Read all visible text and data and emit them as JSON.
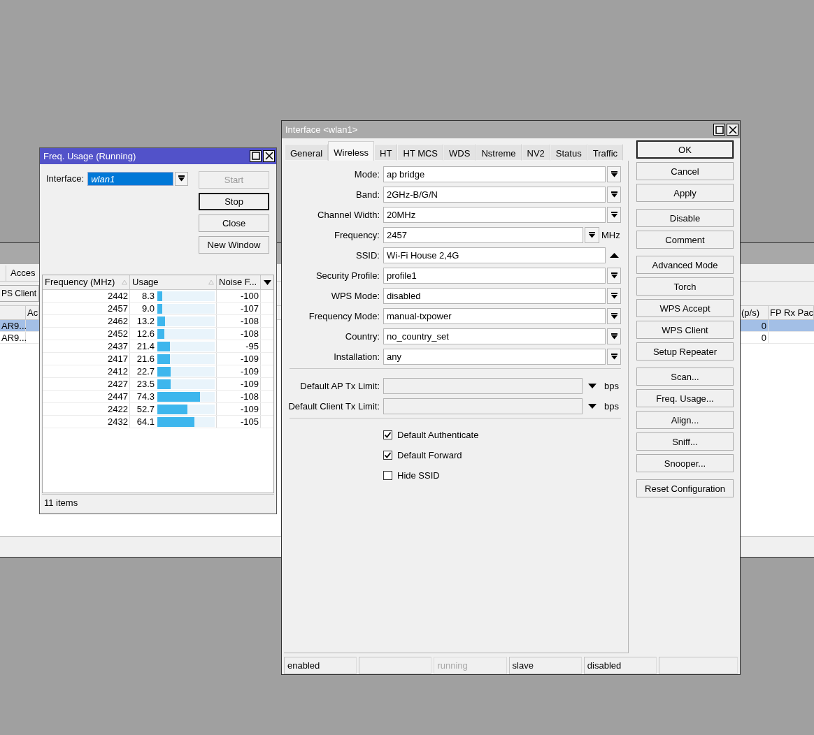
{
  "background_window": {
    "left": {
      "tab": "Acces",
      "button": "PS Client",
      "column_header": "Ac",
      "rows": [
        {
          "cell": "AR9...",
          "selected": true
        },
        {
          "cell": "AR9...",
          "selected": false
        }
      ]
    },
    "right": {
      "column_headers": [
        "(p/s)",
        "FP Rx Pac"
      ],
      "rows": [
        {
          "cell": "0",
          "selected": true
        },
        {
          "cell": "0",
          "selected": false
        }
      ]
    }
  },
  "freq_usage_window": {
    "title": "Freq. Usage (Running)",
    "interface_label": "Interface:",
    "interface_value": "wlan1",
    "buttons": [
      {
        "label": "Start",
        "disabled": true,
        "default": false
      },
      {
        "label": "Stop",
        "disabled": false,
        "default": true
      },
      {
        "label": "Close",
        "disabled": false,
        "default": false
      },
      {
        "label": "New Window",
        "disabled": false,
        "default": false
      }
    ],
    "columns": [
      "Frequency (MHz)",
      "Usage",
      "Noise F..."
    ],
    "rows": [
      {
        "frequency": "2442",
        "usage": "8.3",
        "level": 0.083,
        "noise": "-100"
      },
      {
        "frequency": "2457",
        "usage": "9.0",
        "level": 0.09,
        "noise": "-107"
      },
      {
        "frequency": "2462",
        "usage": "13.2",
        "level": 0.132,
        "noise": "-108"
      },
      {
        "frequency": "2452",
        "usage": "12.6",
        "level": 0.126,
        "noise": "-108"
      },
      {
        "frequency": "2437",
        "usage": "21.4",
        "level": 0.214,
        "noise": "-95"
      },
      {
        "frequency": "2417",
        "usage": "21.6",
        "level": 0.216,
        "noise": "-109"
      },
      {
        "frequency": "2412",
        "usage": "22.7",
        "level": 0.227,
        "noise": "-109"
      },
      {
        "frequency": "2427",
        "usage": "23.5",
        "level": 0.235,
        "noise": "-109"
      },
      {
        "frequency": "2447",
        "usage": "74.3",
        "level": 0.743,
        "noise": "-108"
      },
      {
        "frequency": "2422",
        "usage": "52.7",
        "level": 0.527,
        "noise": "-109"
      },
      {
        "frequency": "2432",
        "usage": "64.1",
        "level": 0.641,
        "noise": "-105"
      }
    ],
    "status": "11 items"
  },
  "interface_window": {
    "title": "Interface <wlan1>",
    "tabs": [
      {
        "label": "General",
        "selected": false
      },
      {
        "label": "Wireless",
        "selected": true
      },
      {
        "label": "HT",
        "selected": false
      },
      {
        "label": "HT MCS",
        "selected": false
      },
      {
        "label": "WDS",
        "selected": false
      },
      {
        "label": "Nstreme",
        "selected": false
      },
      {
        "label": "NV2",
        "selected": false
      },
      {
        "label": "Status",
        "selected": false
      },
      {
        "label": "Traffic",
        "selected": false
      }
    ],
    "fields": [
      {
        "kind": "select",
        "label": "Mode:",
        "value": "ap bridge"
      },
      {
        "kind": "select",
        "label": "Band:",
        "value": "2GHz-B/G/N"
      },
      {
        "kind": "select",
        "label": "Channel Width:",
        "value": "20MHz"
      },
      {
        "kind": "unit_select",
        "label": "Frequency:",
        "value": "2457",
        "unit": "MHz"
      },
      {
        "kind": "text",
        "label": "SSID:",
        "value": "Wi-Fi House 2,4G"
      },
      {
        "kind": "select",
        "label": "Security Profile:",
        "value": "profile1"
      },
      {
        "kind": "select",
        "label": "WPS Mode:",
        "value": "disabled"
      },
      {
        "kind": "select",
        "label": "Frequency Mode:",
        "value": "manual-txpower"
      },
      {
        "kind": "select",
        "label": "Country:",
        "value": "no_country_set"
      },
      {
        "kind": "select",
        "label": "Installation:",
        "value": "any"
      },
      {
        "kind": "separator"
      },
      {
        "kind": "limit",
        "label": "Default AP Tx Limit:",
        "unit": "bps"
      },
      {
        "kind": "limit",
        "label": "Default Client Tx Limit:",
        "unit": "bps"
      },
      {
        "kind": "separator"
      }
    ],
    "checkboxes": [
      {
        "label": "Default Authenticate",
        "checked": true
      },
      {
        "label": "Default Forward",
        "checked": true
      },
      {
        "label": "Hide SSID",
        "checked": false
      }
    ],
    "button_groups": [
      [
        {
          "label": "OK",
          "default": true
        },
        {
          "label": "Cancel",
          "default": false
        },
        {
          "label": "Apply",
          "default": false
        }
      ],
      [
        {
          "label": "Disable",
          "default": false
        },
        {
          "label": "Comment",
          "default": false
        }
      ],
      [
        {
          "label": "Advanced Mode",
          "default": false
        },
        {
          "label": "Torch",
          "default": false
        },
        {
          "label": "WPS Accept",
          "default": false
        },
        {
          "label": "WPS Client",
          "default": false
        },
        {
          "label": "Setup Repeater",
          "default": false
        }
      ],
      [
        {
          "label": "Scan...",
          "default": false
        },
        {
          "label": "Freq. Usage...",
          "default": false
        },
        {
          "label": "Align...",
          "default": false
        },
        {
          "label": "Sniff...",
          "default": false
        },
        {
          "label": "Snooper...",
          "default": false
        }
      ],
      [
        {
          "label": "Reset Configuration",
          "default": false
        }
      ]
    ],
    "status": [
      {
        "text": "enabled",
        "dim": false
      },
      {
        "dim": false
      },
      {
        "text": "running",
        "dim": true
      },
      {
        "text": "slave",
        "dim": false
      },
      {
        "text": "disabled",
        "dim": false
      },
      {
        "dim": false
      }
    ]
  }
}
